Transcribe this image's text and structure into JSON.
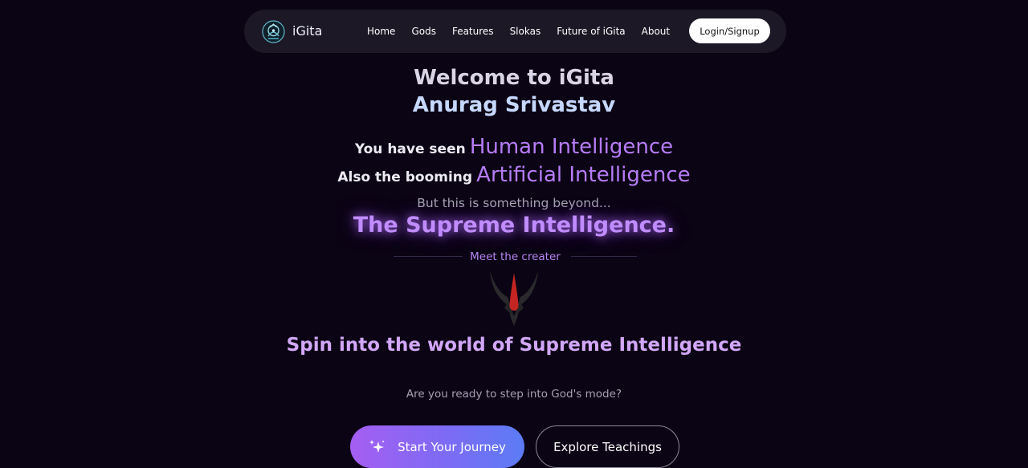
{
  "navbar": {
    "brand": "iGita",
    "logo_icon": "igita-logo-icon",
    "links": [
      "Home",
      "Gods",
      "Features",
      "Slokas",
      "Future of iGita",
      "About"
    ],
    "login_label": "Login/Signup"
  },
  "hero": {
    "title_line1": "Welcome to iGita",
    "title_line2": "Anurag Srivastav",
    "human_prefix": "You have seen",
    "human_highlight": "Human Intelligence",
    "ai_prefix": "Also the booming",
    "ai_highlight": "Artificial Intelligence",
    "beyond": "But this is something beyond...",
    "supreme": "The Supreme Intelligence.",
    "meet": "Meet the creater",
    "tilak_icon": "tilak-icon",
    "spin": "Spin into the world of Supreme Intelligence",
    "ready": "Are you ready to step into God's mode?"
  },
  "actions": {
    "primary_label": "Start Your Journey",
    "primary_icon": "sparkles-icon",
    "secondary_label": "Explore Teachings"
  },
  "colors": {
    "background": "#0b0414",
    "navbar_bg": "#1d1826",
    "accent_purple": "#b67cf7",
    "gradient_start": "#a55ef2",
    "gradient_end": "#5c7bf5"
  }
}
